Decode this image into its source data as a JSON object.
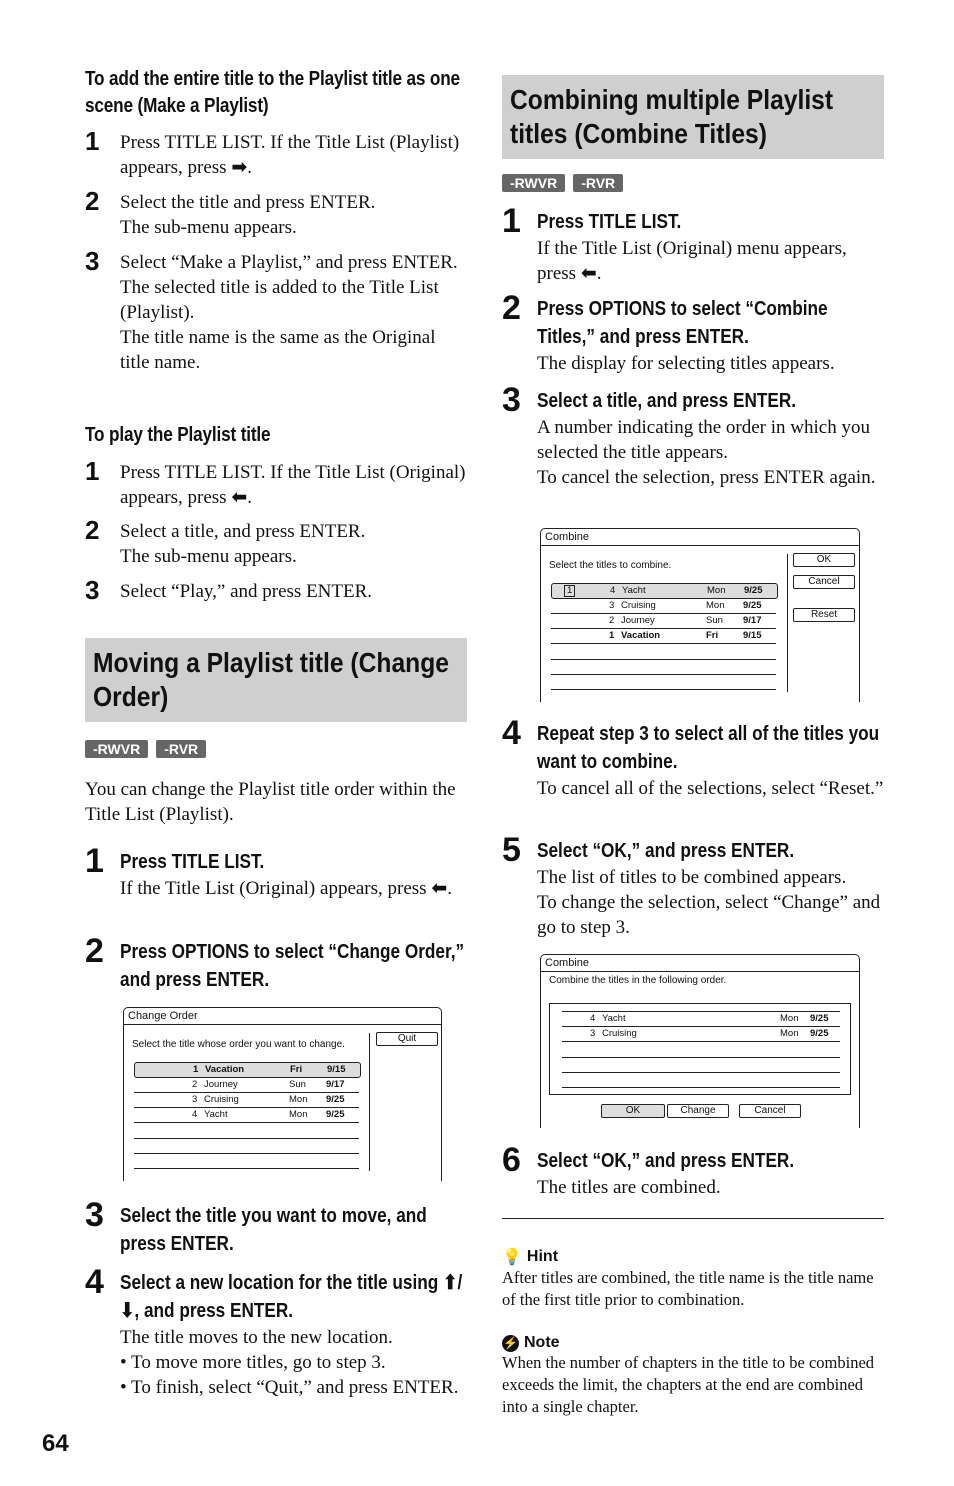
{
  "left": {
    "make_playlist": {
      "heading": "To add the entire title to the Playlist title as one scene (Make a Playlist)",
      "steps": [
        {
          "num": "1",
          "lines": [
            "Press TITLE LIST. If the Title List (Playlist) appears, press",
            "."
          ],
          "icon": "right-arrow"
        },
        {
          "num": "2",
          "lines": [
            "Select the title and press ENTER.",
            "The sub-menu appears."
          ]
        },
        {
          "num": "3",
          "lines": [
            "Select “Make a Playlist,” and press ENTER.",
            "The selected title is added to the Title List (Playlist).",
            "The title name is the same as the Original title name."
          ]
        }
      ]
    },
    "play_playlist": {
      "heading": "To play the Playlist title",
      "steps": [
        {
          "num": "1",
          "lines": [
            "Press TITLE LIST. If the Title List (Original) appears, press",
            "."
          ],
          "icon": "left-arrow"
        },
        {
          "num": "2",
          "lines": [
            "Select a title, and press ENTER.",
            "The sub-menu appears."
          ]
        },
        {
          "num": "3",
          "lines": [
            "Select “Play,” and press ENTER."
          ]
        }
      ]
    },
    "change_order": {
      "banner": "Moving a Playlist title (Change Order)",
      "badges": [
        "-RWVR",
        "-RVR"
      ],
      "intro": "You can change the Playlist title order within the Title List (Playlist).",
      "steps": [
        {
          "num": "1",
          "title": "Press TITLE LIST.",
          "body": "If the Title List (Original) appears, press",
          "tail": "."
        },
        {
          "num": "2",
          "title": "Press OPTIONS to select “Change Order,” and press ENTER."
        },
        {
          "num": "3",
          "title": "Select the title you want to move, and press ENTER."
        },
        {
          "num": "4",
          "title_a": "Select a new location for the title using",
          "title_b": ", and press ENTER.",
          "body": "The title moves to the new location.",
          "bullets": [
            "• To move more titles, go to step 3.",
            "• To finish, select “Quit,” and press ENTER."
          ]
        }
      ],
      "screen": {
        "title": "Change Order",
        "prompt": "Select the title whose order you want to change.",
        "button": "Quit",
        "rows": [
          {
            "no": "1",
            "name": "Vacation",
            "day": "Fri",
            "date": "9/15",
            "selected": true
          },
          {
            "no": "2",
            "name": "Journey",
            "day": "Sun",
            "date": "9/17"
          },
          {
            "no": "3",
            "name": "Cruising",
            "day": "Mon",
            "date": "9/25"
          },
          {
            "no": "4",
            "name": "Yacht",
            "day": "Mon",
            "date": "9/25"
          }
        ]
      }
    },
    "page_number": "64"
  },
  "right": {
    "banner": "Combining multiple Playlist titles (Combine Titles)",
    "badges": [
      "-RWVR",
      "-RVR"
    ],
    "steps": [
      {
        "num": "1",
        "title": "Press TITLE LIST.",
        "body": "If the Title List (Original) menu appears, press",
        "tail": "."
      },
      {
        "num": "2",
        "title": "Press OPTIONS to select “Combine Titles,” and press ENTER.",
        "body": "The display for selecting titles appears."
      },
      {
        "num": "3",
        "title": "Select a title, and press ENTER.",
        "body": "A number indicating the order in which you selected the title appears.",
        "body2": "To cancel the selection, press ENTER again."
      },
      {
        "num": "4",
        "title": "Repeat step 3 to select all of the titles you want to combine.",
        "body": "To cancel all of the selections, select “Reset.”"
      },
      {
        "num": "5",
        "title": "Select “OK,” and press ENTER.",
        "body": "The list of titles to be combined appears.",
        "body2": "To change the selection, select “Change” and go to step 3."
      },
      {
        "num": "6",
        "title": "Select “OK,” and press ENTER.",
        "body": "The titles are combined."
      }
    ],
    "screen1": {
      "title": "Combine",
      "prompt": "Select the titles to combine.",
      "buttons": [
        "OK",
        "Cancel",
        "Reset"
      ],
      "rows": [
        {
          "mark": "1",
          "no": "4",
          "name": "Yacht",
          "day": "Mon",
          "date": "9/25",
          "selected": true
        },
        {
          "no": "3",
          "name": "Cruising",
          "day": "Mon",
          "date": "9/25"
        },
        {
          "no": "2",
          "name": "Journey",
          "day": "Sun",
          "date": "9/17"
        },
        {
          "no": "1",
          "name": "Vacation",
          "day": "Fri",
          "date": "9/15",
          "bold": true
        }
      ]
    },
    "screen2": {
      "title": "Combine",
      "prompt": "Combine the titles in the following order.",
      "buttons": [
        "OK",
        "Change",
        "Cancel"
      ],
      "rows": [
        {
          "no": "4",
          "name": "Yacht",
          "day": "Mon",
          "date": "9/25"
        },
        {
          "no": "3",
          "name": "Cruising",
          "day": "Mon",
          "date": "9/25"
        }
      ]
    },
    "hint": {
      "label": "Hint",
      "text": "After titles are combined, the title name is the title name of the first title prior to combination."
    },
    "note": {
      "label": "Note",
      "text": "When the number of chapters in the title to be combined exceeds the limit, the chapters at the end are combined into a single chapter."
    }
  }
}
